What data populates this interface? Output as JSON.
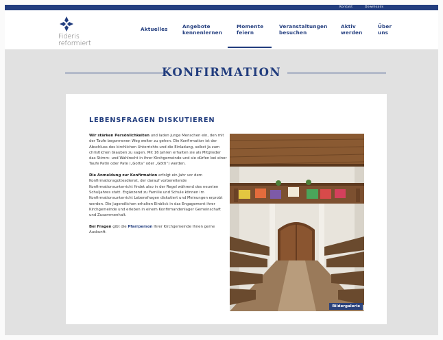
{
  "topbar": {
    "links": [
      {
        "label": "Kontakt"
      },
      {
        "label": "Downloads"
      }
    ]
  },
  "logo": {
    "line1": "Fideris",
    "line2": "reformiert"
  },
  "nav": {
    "items": [
      {
        "line1": "Aktuelles",
        "line2": ""
      },
      {
        "line1": "Angebote",
        "line2": "kennenlernen"
      },
      {
        "line1": "Momente",
        "line2": "feiern"
      },
      {
        "line1": "Veranstaltungen",
        "line2": "besuchen"
      },
      {
        "line1": "Aktiv",
        "line2": "werden"
      },
      {
        "line1": "Über",
        "line2": "uns"
      }
    ],
    "active": "Momente feiern"
  },
  "page": {
    "title": "KONFIRMATION"
  },
  "section": {
    "title": "LEBENSFRAGEN DISKUTIEREN",
    "p1_bold": "Wir stärken Persönlichkeiten",
    "p1_rest": " und laden junge Menschen ein, den mit der Taufe begonnenen Weg weiter zu gehen. Die Konfirmation ist der Abschluss des kirchlichen Unterrichts und die Einladung, selbst Ja zum christlichen Glauben zu sagen. Mit 16 Jahren erhalten sie als Mitglieder das Stimm- und Wahlrecht in ihrer Kirchgemeinde und sie dürfen bei einer Taufe Patin oder Pate („Gotta“ oder „Götti“) werden.",
    "p2_bold": "Die Anmeldung zur Konfirmation",
    "p2_rest": " erfolgt ein Jahr vor dem Konfirmationsgottesdienst, der darauf vorbereitende Konfirmationsunterricht findet also in der Regel während des neunten Schuljahres statt. Ergänzend zu Familie und Schule können im Konfirmationsunterricht Lebensfragen diskutiert und Meinungen erprobt werden. Die Jugendlichen erhalten Einblick in das Engagement ihrer Kirchgemeinde und erleben in einem Konfirmandenlager Gemeinschaft und Zusammenhalt.",
    "p3_bold": "Bei Fragen",
    "p3_mid": " gibt die ",
    "p3_link": "Pfarrperson",
    "p3_rest": " Ihrer Kirchgemeinde Ihnen gerne Auskunft."
  },
  "photo": {
    "gallery_label": "Bildergalerie"
  },
  "colors": {
    "brand_blue": "#223d7e",
    "page_bg": "#e1e1e1",
    "card_bg": "#ffffff"
  },
  "icons": {
    "logo": "cross-logo-icon"
  }
}
